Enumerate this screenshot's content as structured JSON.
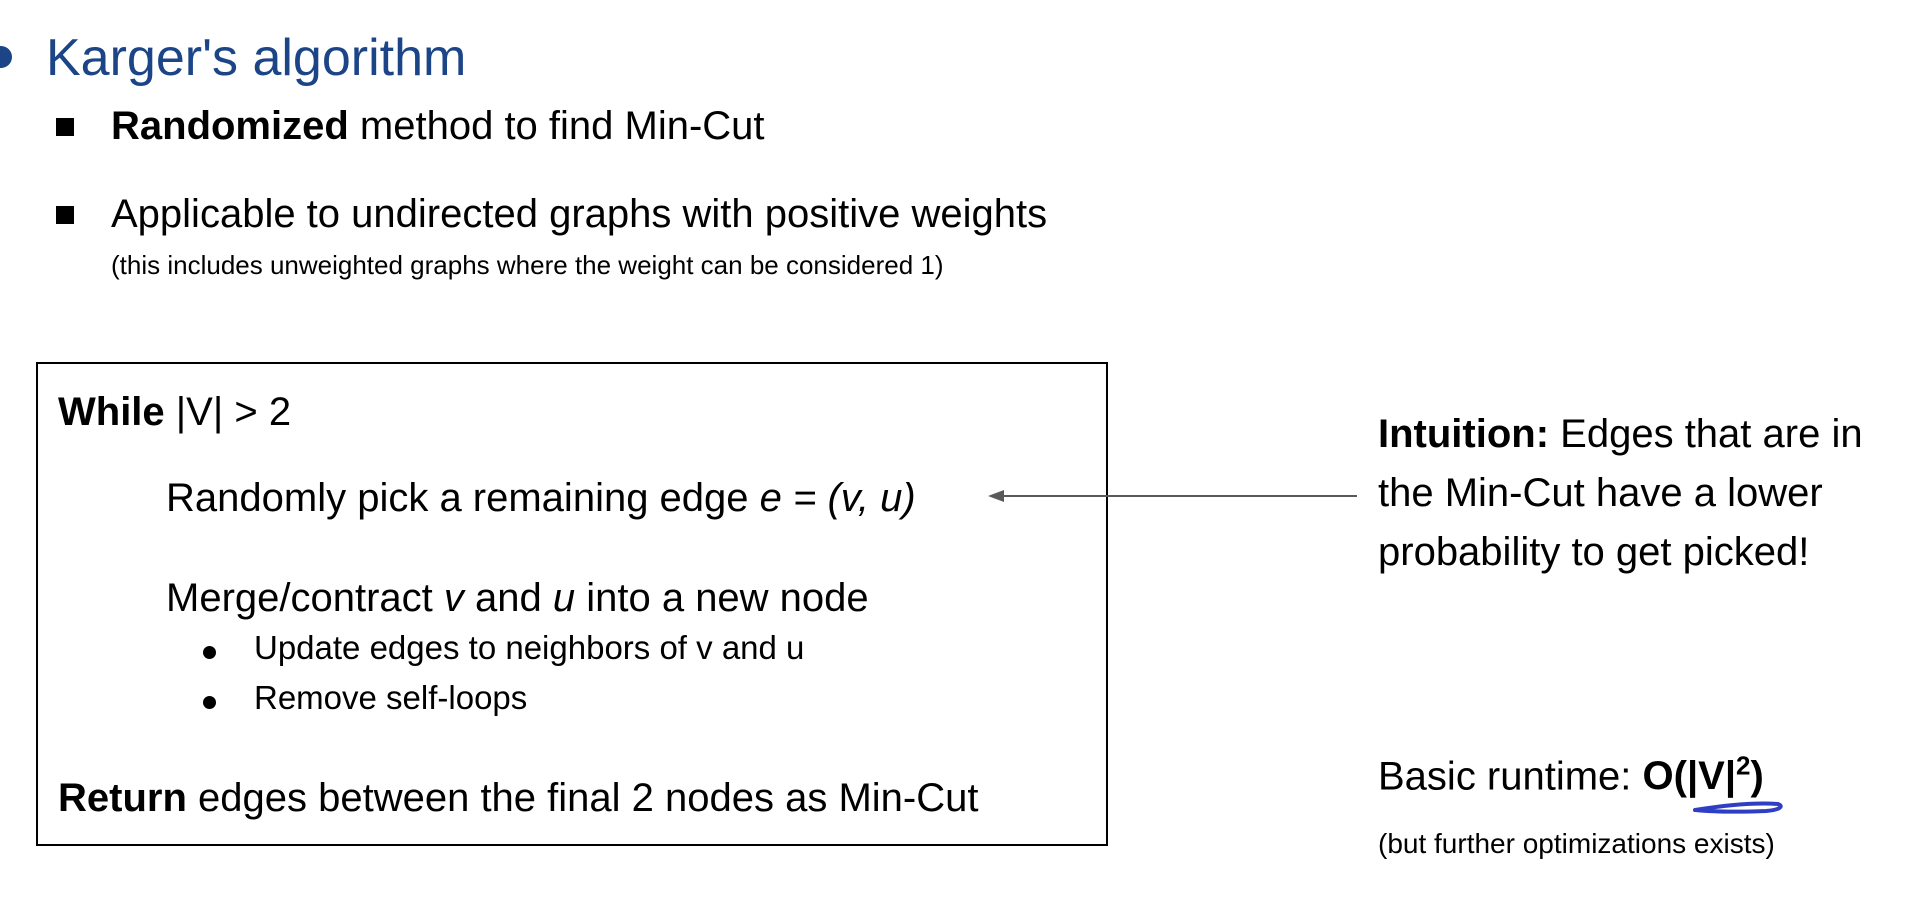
{
  "title": "Karger's algorithm",
  "bullets": [
    {
      "bold": "Randomized",
      "rest": " method to find Min-Cut"
    },
    {
      "text": "Applicable to undirected graphs with positive weights",
      "note": "(this includes unweighted graphs where the weight can be considered 1)"
    }
  ],
  "algorithm": {
    "while_keyword": "While",
    "while_cond": " |V| > 2",
    "pick_text": "Randomly pick a remaining edge ",
    "pick_edge": "e = (v, u)",
    "merge_pre": "Merge/contract ",
    "merge_v": "v",
    "merge_mid": " and ",
    "merge_u": "u",
    "merge_post": " into a new node",
    "substeps": [
      "Update edges to neighbors of v and u",
      "Remove self-loops"
    ],
    "return_keyword": "Return",
    "return_text": " edges between the final 2 nodes as Min-Cut"
  },
  "intuition": {
    "label": "Intuition:",
    "line1": " Edges that are in",
    "line2": "the Min-Cut have a lower",
    "line3": "probability to get picked!"
  },
  "runtime": {
    "label": "Basic runtime: ",
    "complexity_base": "O(|V|",
    "complexity_exp": "2",
    "complexity_close": ")",
    "note": "(but further optimizations exists)"
  },
  "colors": {
    "title": "#1c4587",
    "annotation_underline": "#2f3fc4",
    "arrow": "#595959"
  }
}
